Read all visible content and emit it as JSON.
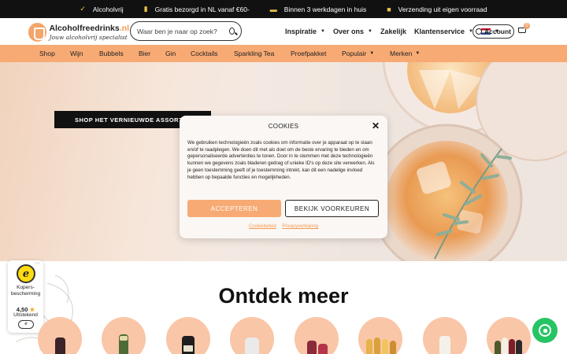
{
  "usp_bar": {
    "items": [
      {
        "icon": "check-icon",
        "text": "Alcoholvrij"
      },
      {
        "icon": "bottle-icon",
        "text": "Gratis bezorgd in NL vanaf €60-"
      },
      {
        "icon": "truck-icon",
        "text": "Binnen 3 werkdagen in huis"
      },
      {
        "icon": "gift-icon",
        "text": "Verzending uit eigen voorraad"
      }
    ]
  },
  "header": {
    "logo_name": "Alcoholfreedrinks",
    "logo_tld": ".nl",
    "logo_tagline": "Jouw alcoholvrij specialist",
    "search_placeholder": "Waar ben je naar op zoek?",
    "nav": [
      {
        "label": "Inspiratie",
        "has_dropdown": true
      },
      {
        "label": "Over ons",
        "has_dropdown": true
      },
      {
        "label": "Zakelijk",
        "has_dropdown": false
      },
      {
        "label": "Klantenservice",
        "has_dropdown": true
      }
    ],
    "language": "NL",
    "account_label": "Account",
    "cart_count": "0"
  },
  "category_bar": {
    "items": [
      {
        "label": "Shop",
        "has_dropdown": false
      },
      {
        "label": "Wijn",
        "has_dropdown": false
      },
      {
        "label": "Bubbels",
        "has_dropdown": false
      },
      {
        "label": "Bier",
        "has_dropdown": false
      },
      {
        "label": "Gin",
        "has_dropdown": false
      },
      {
        "label": "Cocktails",
        "has_dropdown": false
      },
      {
        "label": "Sparkling Tea",
        "has_dropdown": false
      },
      {
        "label": "Proefpakket",
        "has_dropdown": false
      },
      {
        "label": "Populair",
        "has_dropdown": true
      },
      {
        "label": "Merken",
        "has_dropdown": true
      }
    ]
  },
  "hero": {
    "button_label": "SHOP HET VERNIEUWDE ASSORTIMENT"
  },
  "cookie_modal": {
    "title": "COOKIES",
    "text": "We gebruiken technologieën zoals cookies om informatie over je apparaat op te slaan en/of te raadplegen. We doen dit met als doel om de beste ervaring te bieden en om gepersonaliseerde advertenties te tonen. Door in te stemmen met deze technologieën kunnen we gegevens zoals bladeren gedrag of unieke ID's op deze site verwerken. Als je geen toestemming geeft of je toestemming intrekt, kan dit een nadelige invloed hebben op bepaalde functies en mogelijkheden.",
    "accept_label": "ACCEPTEREN",
    "preferences_label": "BEKIJK VOORKEUREN",
    "link_cookie_policy": "Cookiebeleid",
    "link_privacy": "Privacyverklaring"
  },
  "trust_badge": {
    "label": "Kopers-bescherming",
    "score": "4,50",
    "rating_text": "Uitstekend"
  },
  "discover": {
    "title": "Ontdek meer"
  },
  "colors": {
    "accent": "#f8aa74",
    "dark": "#111111",
    "whatsapp": "#27c464"
  }
}
